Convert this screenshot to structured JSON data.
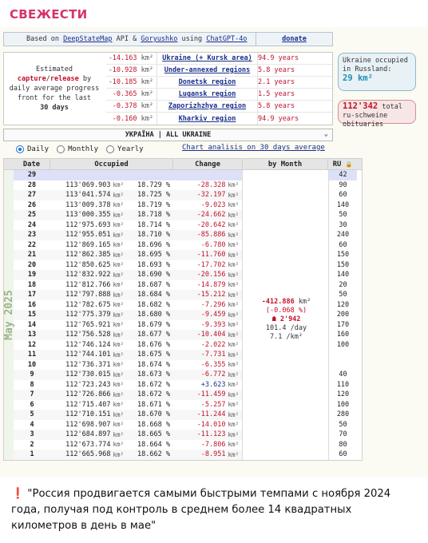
{
  "channel": {
    "title": "СВЕЖЕСТИ"
  },
  "credit": {
    "prefix": "Based on",
    "link1": "DeepStateMap",
    "mid1": "API &",
    "link2": "Goryushko",
    "mid2": "using",
    "link3": "ChatGPT-4o",
    "donate": "donate"
  },
  "summary": {
    "line1": "Estimated",
    "line2a": "capture",
    "line2b": "/",
    "line2c": "release",
    "line2d": "by",
    "line3": "daily average progress",
    "line4": "front for the last",
    "line5": "30 days",
    "rows": [
      {
        "value": "-14.163",
        "unit": "km²",
        "region": "Ukraine (+ Kursk area)",
        "years": "94.9 years"
      },
      {
        "value": "-10.928",
        "unit": "km²",
        "region": "Under-annexed regions",
        "years": "5.8 years"
      },
      {
        "value": "-10.185",
        "unit": "km²",
        "region": "Donetsk region",
        "years": "2.1 years"
      },
      {
        "value": "-0.365",
        "unit": "km²",
        "region": "Lugansk region",
        "years": "1.5 years"
      },
      {
        "value": "-0.378",
        "unit": "km²",
        "region": "Zaporizhzhya region",
        "years": "5.8 years"
      },
      {
        "value": "-0.160",
        "unit": "km²",
        "region": "Kharkiv region",
        "years": "94.9 years"
      }
    ]
  },
  "occupied_box": {
    "line1": "Ukraine occupied",
    "line2": "in Russland:",
    "value": "29 km²"
  },
  "obituaries_box": {
    "value": "112'342",
    "line1": "total",
    "line2": "ru-schweine",
    "line3": "obituaries"
  },
  "region_select": {
    "selected": "УКРАЇНА | ALL UKRAINE"
  },
  "view_mode": {
    "options": [
      "Daily",
      "Monthly",
      "Yearly"
    ],
    "selected": "Daily",
    "chart_link": "Chart analisis on 30 days average"
  },
  "table": {
    "headers": {
      "date": "Date",
      "occupied": "Occupied",
      "change": "Change",
      "by_month": "by Month",
      "ru": "RU"
    },
    "month_label": "May 2025",
    "km_unit": "km²",
    "rows": [
      {
        "date": "29",
        "km": "",
        "pct": "",
        "chg": "",
        "ru": "42"
      },
      {
        "date": "28",
        "km": "113'069.903",
        "pct": "18.729 %",
        "chg": "-28.328",
        "ru": "90"
      },
      {
        "date": "27",
        "km": "113'041.574",
        "pct": "18.725 %",
        "chg": "-32.197",
        "ru": "60"
      },
      {
        "date": "26",
        "km": "113'009.378",
        "pct": "18.719 %",
        "chg": "-9.023",
        "ru": "140"
      },
      {
        "date": "25",
        "km": "113'000.355",
        "pct": "18.718 %",
        "chg": "-24.662",
        "ru": "50"
      },
      {
        "date": "24",
        "km": "112'975.693",
        "pct": "18.714 %",
        "chg": "-20.642",
        "ru": "30"
      },
      {
        "date": "23",
        "km": "112'955.051",
        "pct": "18.710 %",
        "chg": "-85.886",
        "ru": "240"
      },
      {
        "date": "22",
        "km": "112'869.165",
        "pct": "18.696 %",
        "chg": "-6.780",
        "ru": "60"
      },
      {
        "date": "21",
        "km": "112'862.385",
        "pct": "18.695 %",
        "chg": "-11.760",
        "ru": "150"
      },
      {
        "date": "20",
        "km": "112'850.625",
        "pct": "18.693 %",
        "chg": "-17.702",
        "ru": "150"
      },
      {
        "date": "19",
        "km": "112'832.922",
        "pct": "18.690 %",
        "chg": "-20.156",
        "ru": "140"
      },
      {
        "date": "18",
        "km": "112'812.766",
        "pct": "18.687 %",
        "chg": "-14.879",
        "ru": "20"
      },
      {
        "date": "17",
        "km": "112'797.888",
        "pct": "18.684 %",
        "chg": "-15.212",
        "ru": "50"
      },
      {
        "date": "16",
        "km": "112'782.675",
        "pct": "18.682 %",
        "chg": "-7.296",
        "ru": "120"
      },
      {
        "date": "15",
        "km": "112'775.379",
        "pct": "18.680 %",
        "chg": "-9.459",
        "ru": "200"
      },
      {
        "date": "14",
        "km": "112'765.921",
        "pct": "18.679 %",
        "chg": "-9.393",
        "ru": "170"
      },
      {
        "date": "13",
        "km": "112'756.528",
        "pct": "18.677 %",
        "chg": "-10.404",
        "ru": "160"
      },
      {
        "date": "12",
        "km": "112'746.124",
        "pct": "18.676 %",
        "chg": "-2.022",
        "ru": "100"
      },
      {
        "date": "11",
        "km": "112'744.101",
        "pct": "18.675 %",
        "chg": "-7.731",
        "ru": ""
      },
      {
        "date": "10",
        "km": "112'736.371",
        "pct": "18.674 %",
        "chg": "-6.355",
        "ru": ""
      },
      {
        "date": "9",
        "km": "112'730.015",
        "pct": "18.673 %",
        "chg": "-6.772",
        "ru": "40"
      },
      {
        "date": "8",
        "km": "112'723.243",
        "pct": "18.672 %",
        "chg": "+3.623",
        "ru": "110"
      },
      {
        "date": "7",
        "km": "112'726.866",
        "pct": "18.672 %",
        "chg": "-11.459",
        "ru": "120"
      },
      {
        "date": "6",
        "km": "112'715.407",
        "pct": "18.671 %",
        "chg": "-5.257",
        "ru": "100"
      },
      {
        "date": "5",
        "km": "112'710.151",
        "pct": "18.670 %",
        "chg": "-11.244",
        "ru": "280"
      },
      {
        "date": "4",
        "km": "112'698.907",
        "pct": "18.668 %",
        "chg": "-14.010",
        "ru": "50"
      },
      {
        "date": "3",
        "km": "112'684.897",
        "pct": "18.665 %",
        "chg": "-11.123",
        "ru": "70"
      },
      {
        "date": "2",
        "km": "112'673.774",
        "pct": "18.664 %",
        "chg": "-7.806",
        "ru": "80"
      },
      {
        "date": "1",
        "km": "112'665.968",
        "pct": "18.662 %",
        "chg": "-8.951",
        "ru": "60"
      }
    ],
    "month_summary": {
      "change": "-412.886",
      "change_unit": "km²",
      "change_pct": "(-0.068 %)",
      "ru_total": "2'942",
      "ru_per_day": "101.4 /day",
      "km_per_day": "7.1 /km²"
    }
  },
  "caption": {
    "mark": "❗",
    "text": "\"Россия продвигается самыми быстрыми темпами с ноября 2024 года, получая под контроль в среднем более 14 квадратных километров в день в мае\""
  },
  "colors": {
    "title": "#d6336c",
    "loss": "#c0132b",
    "link": "#1a2f8a",
    "occupied": "#1f8fb0"
  }
}
